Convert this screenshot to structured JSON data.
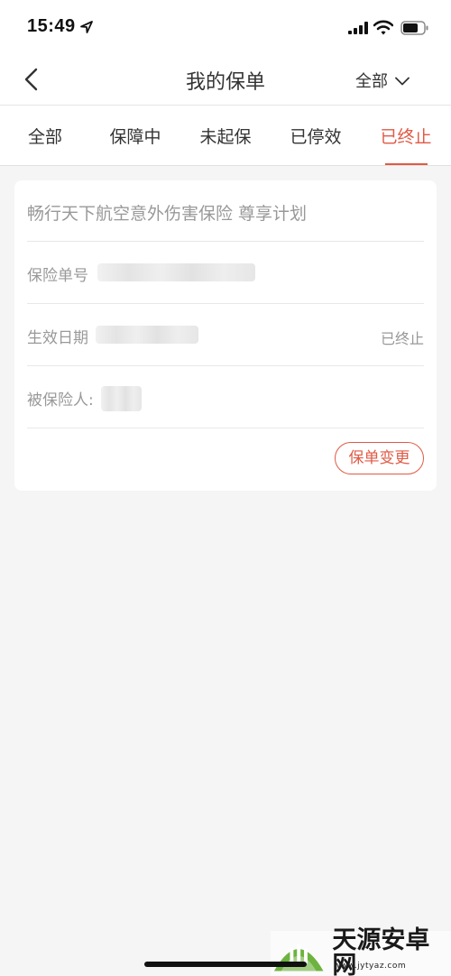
{
  "status_bar": {
    "time": "15:49"
  },
  "nav": {
    "title": "我的保单",
    "filter_label": "全部"
  },
  "tabs": [
    {
      "label": "全部",
      "active": false
    },
    {
      "label": "保障中",
      "active": false
    },
    {
      "label": "未起保",
      "active": false
    },
    {
      "label": "已停效",
      "active": false
    },
    {
      "label": "已终止",
      "active": true
    }
  ],
  "policy_card": {
    "title": "畅行天下航空意外伤害保险 尊享计划",
    "policy_number_label": "保险单号",
    "effective_date_label": "生效日期",
    "status": "已终止",
    "insured_label": "被保险人:",
    "change_button": "保单变更"
  },
  "watermark": {
    "text": "天源安卓网",
    "url": "www.jytyaz.com"
  },
  "colors": {
    "accent": "#e05a45",
    "muted_text": "#999999",
    "background": "#f5f5f5"
  }
}
